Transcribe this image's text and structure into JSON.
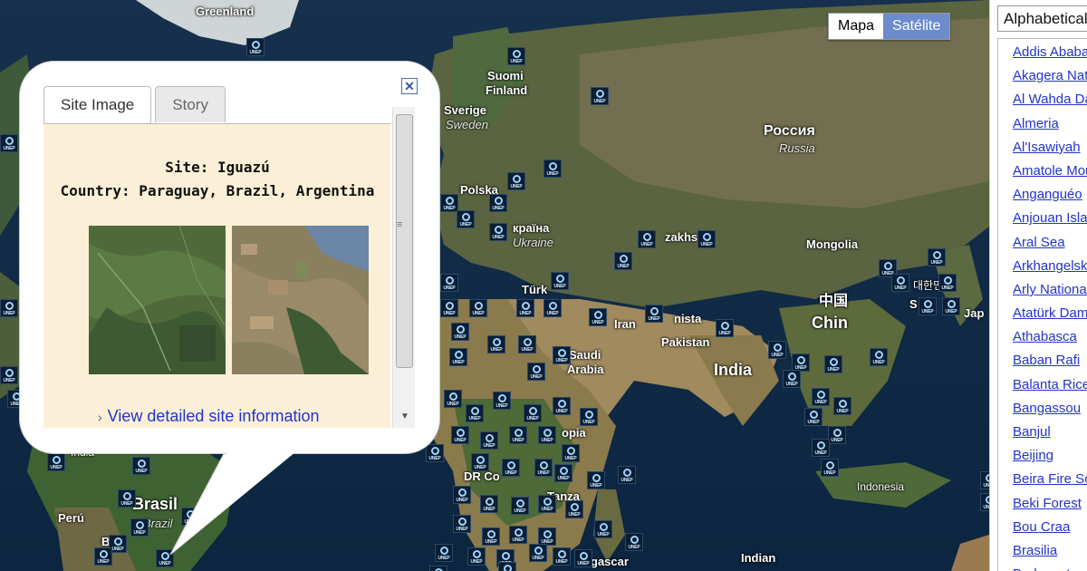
{
  "map": {
    "type_control": {
      "map_label": "Mapa",
      "satellite_label": "Satélite",
      "selected": "Satélite"
    },
    "labels": {
      "greenland": "Greenland",
      "suomi": "Suomi",
      "finland": "Finland",
      "sverige": "Sverige",
      "sweden": "Sweden",
      "polska": "Polska",
      "ukraina_native": "країна",
      "ukraine": "Ukraine",
      "russia_native": "Россия",
      "russia": "Russia",
      "kazakh": "zakhs",
      "mongolia": "Mongolia",
      "turkey": "Türk",
      "iran": "Iran",
      "pakistan_a": "nista",
      "pakistan": "Pakistan",
      "saudi_a": "Saudi",
      "saudi_b": "Arabia",
      "india": "India",
      "china_native": "中国",
      "china": "Chin",
      "korea_native": "대한민국",
      "korea": "S Ko",
      "japan": "Jap",
      "ethiopia": "opia",
      "dr_congo": "DR Co",
      "tanzania": "Tanza",
      "indonesia": "Indonesia",
      "madagascar": "gascar",
      "indian_ocean_a": "Indian",
      "india_south": "India",
      "brasil": "Brasil",
      "brazil": "Brazil",
      "peru": "Perú",
      "bolivia": "Bo"
    }
  },
  "info_window": {
    "tabs": [
      "Site Image",
      "Story"
    ],
    "active_tab": "Site Image",
    "site_line": "Site: Iguazú",
    "country_line": "Country: Paraguay, Brazil, Argentina",
    "link_text": "View detailed site information",
    "close_symbol": "✕"
  },
  "sidebar": {
    "sort_value": "Alphabetical",
    "sites": [
      "Addis Ababa",
      "Akagera National Park",
      "Al Wahda Dam",
      "Almeria",
      "Al'Isawiyah",
      "Amatole Mountains",
      "Anganguéo",
      "Anjouan Island",
      "Aral Sea",
      "Arkhangelsk",
      "Arly National Park",
      "Atatürk Dam",
      "Athabasca",
      "Baban Rafi",
      "Balanta Rice",
      "Bangassou",
      "Banjul",
      "Beijing",
      "Beira Fire Scars",
      "Beki Forest",
      "Bou Craa",
      "Brasilia",
      "Budapest"
    ]
  }
}
